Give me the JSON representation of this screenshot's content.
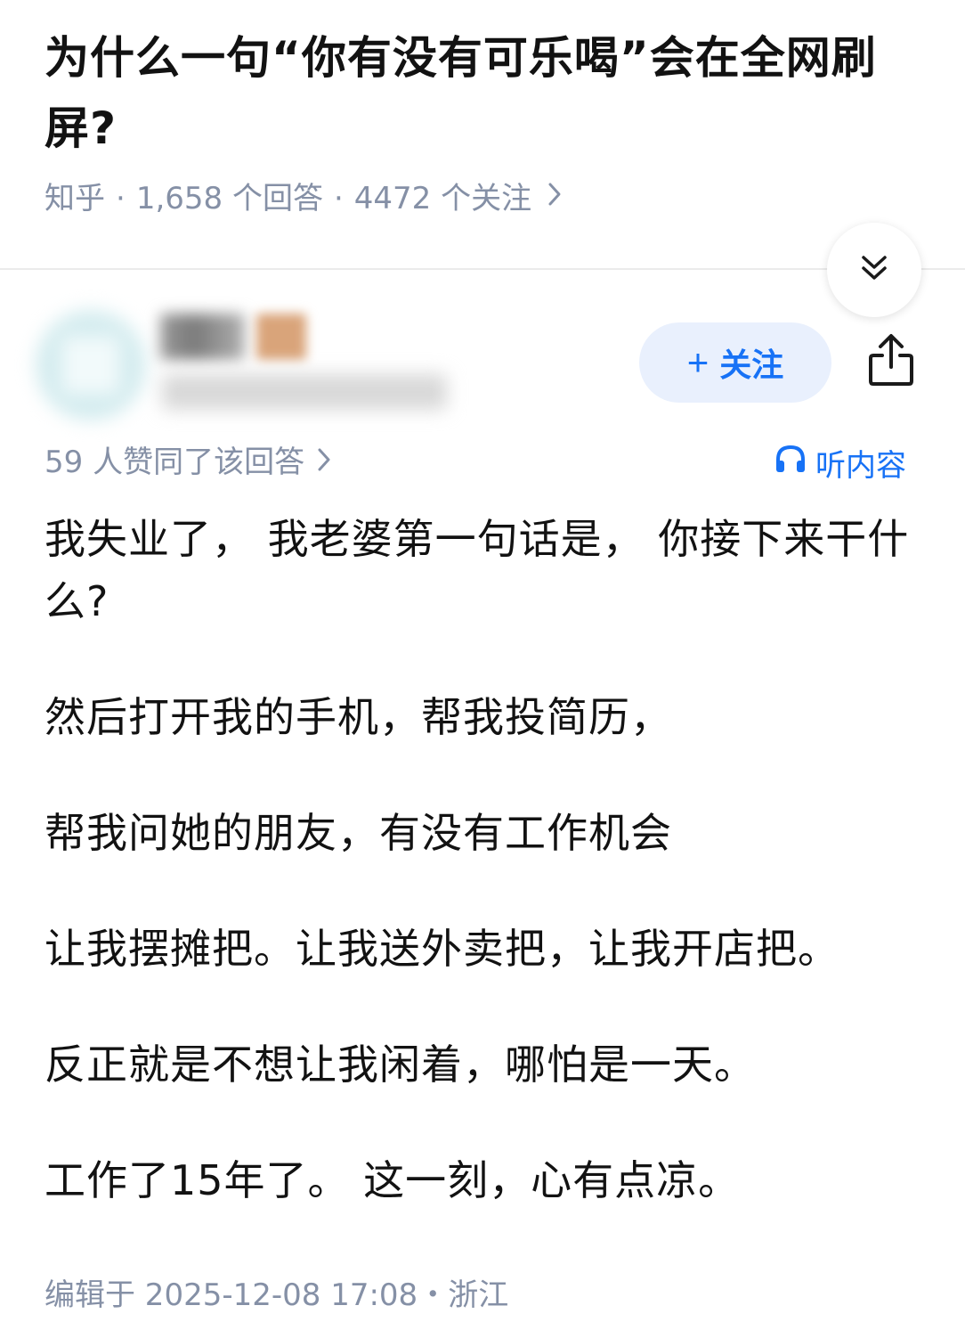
{
  "question": {
    "title": "为什么一句“你有没有可乐喝”会在全网刷屏?",
    "source": "知乎",
    "answers_count": "1,658 个回答",
    "followers_count": "4472 个关注",
    "separator": "·"
  },
  "answer": {
    "follow_label": "关注",
    "upvote_text": "59 人赞同了该回答",
    "listen_label": "听内容",
    "paragraphs": [
      "我失业了， 我老婆第一句话是， 你接下来干什么?",
      "然后打开我的手机，帮我投简历，",
      "帮我问她的朋友，有没有工作机会",
      "让我摆摊把。让我送外卖把，让我开店把。",
      "反正就是不想让我闲着，哪怕是一天。",
      "工作了15年了。 这一刻，心有点凉。"
    ],
    "edited_text": "编辑于 2025-12-08 17:08・浙江"
  },
  "colors": {
    "accent": "#1772f6",
    "meta_gray": "#8590a6",
    "follow_bg": "#e9f0fd"
  },
  "icons": {
    "collapse": "double-chevron-down-icon",
    "share": "share-icon",
    "headphones": "headphones-icon",
    "chevron": "chevron-right-icon"
  }
}
